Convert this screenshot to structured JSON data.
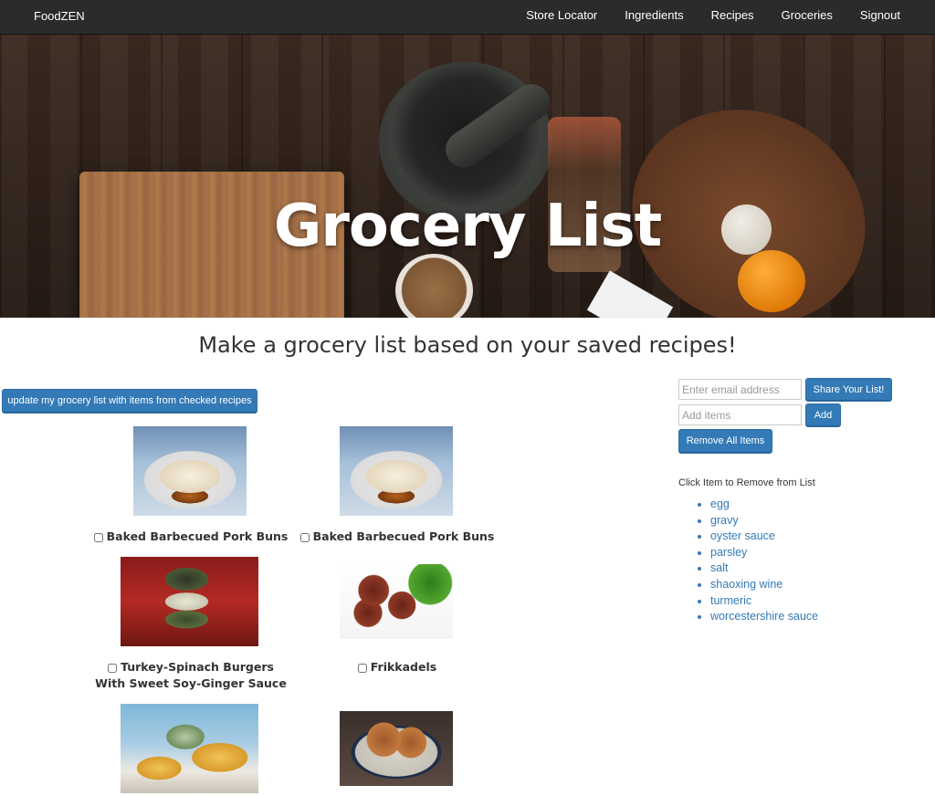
{
  "navbar": {
    "brand": "FoodZEN",
    "links": [
      "Store Locator",
      "Ingredients",
      "Recipes",
      "Groceries",
      "Signout"
    ]
  },
  "hero": {
    "title": "Grocery List"
  },
  "subtitle": "Make a grocery list based on your saved recipes!",
  "update_button": "update my grocery list with items from checked recipes",
  "recipes": [
    {
      "name": "Baked Barbecued Pork Buns",
      "checked": false
    },
    {
      "name": "Baked Barbecued Pork Buns",
      "checked": false
    },
    {
      "name": "Turkey-Spinach Burgers With Sweet Soy-Ginger Sauce",
      "checked": false
    },
    {
      "name": "Frikkadels",
      "checked": false
    }
  ],
  "sidebar": {
    "email_placeholder": "Enter email address",
    "share_button": "Share Your List!",
    "add_placeholder": "Add items",
    "add_button": "Add",
    "remove_all_button": "Remove All Items",
    "hint": "Click Item to Remove from List",
    "items": [
      "egg",
      "gravy",
      "oyster sauce",
      "parsley",
      "salt",
      "shaoxing wine",
      "turmeric",
      "worcestershire sauce"
    ]
  },
  "colors": {
    "navbar": "#2b2b2b",
    "primary": "#337ab7",
    "link": "#337ab7"
  }
}
